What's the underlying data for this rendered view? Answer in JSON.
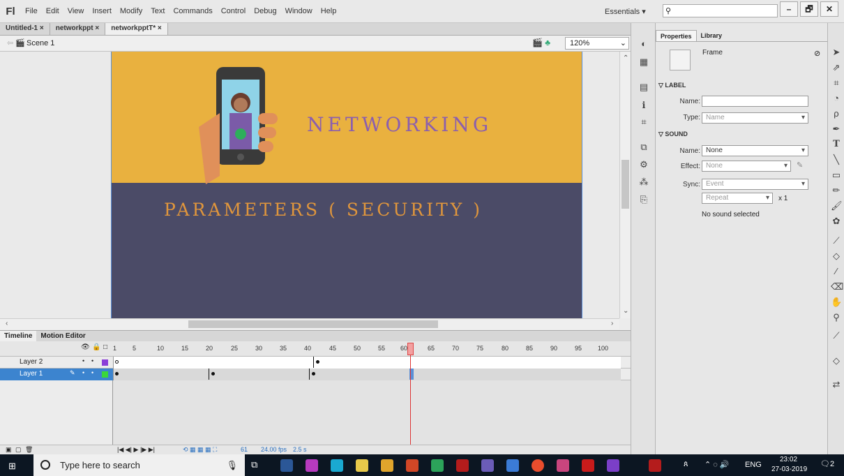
{
  "app": {
    "logo": "Fl"
  },
  "menu": [
    "File",
    "Edit",
    "View",
    "Insert",
    "Modify",
    "Text",
    "Commands",
    "Control",
    "Debug",
    "Window",
    "Help"
  ],
  "workspace": {
    "label": "Essentials ▾",
    "search_placeholder": ""
  },
  "window_controls": {
    "minimize": "–",
    "maximize": "🗗",
    "close": "✕"
  },
  "doc_tabs": [
    {
      "label": "Untitled-1 ×"
    },
    {
      "label": "networkppt ×"
    },
    {
      "label": "networkpptT* ×"
    }
  ],
  "edit_bar": {
    "scene": "Scene 1",
    "zoom": "120%"
  },
  "stage": {
    "title": "NETWORKING",
    "subtitle": "PARAMETERS ( SECURITY )",
    "colors": {
      "top_band": "#e9b13f",
      "bottom_band": "#4b4b67",
      "title": "#8b5fae",
      "subtitle": "#e0963c"
    }
  },
  "timeline": {
    "tabs": [
      "Timeline",
      "Motion Editor"
    ],
    "frame_numbers": [
      "1",
      "5",
      "10",
      "15",
      "20",
      "25",
      "30",
      "35",
      "40",
      "45",
      "50",
      "55",
      "60",
      "65",
      "70",
      "75",
      "80",
      "85",
      "90",
      "95",
      "100"
    ],
    "current_frame": "61",
    "layers": [
      {
        "name": "Layer 2",
        "selected": false
      },
      {
        "name": "Layer 1",
        "selected": true
      }
    ],
    "footer": {
      "frame": "61",
      "fps": "24.00 fps",
      "time": "2.5 s"
    }
  },
  "properties": {
    "tabs": [
      "Properties",
      "Library"
    ],
    "type_label": "Frame",
    "label_section": "LABEL",
    "name_label": "Name:",
    "name_value": "",
    "type_field_label": "Type:",
    "type_value": "Name",
    "sound_section": "SOUND",
    "sound_name_label": "Name:",
    "sound_name_value": "None",
    "effect_label": "Effect:",
    "effect_value": "None",
    "sync_label": "Sync:",
    "sync_value": "Event",
    "repeat_value": "Repeat",
    "repeat_count": "x 1",
    "status": "No sound selected"
  },
  "taskbar": {
    "search_placeholder": "Type here to search",
    "language": "ENG",
    "time": "23:02",
    "date": "27-03-2019",
    "notification_count": "2"
  }
}
